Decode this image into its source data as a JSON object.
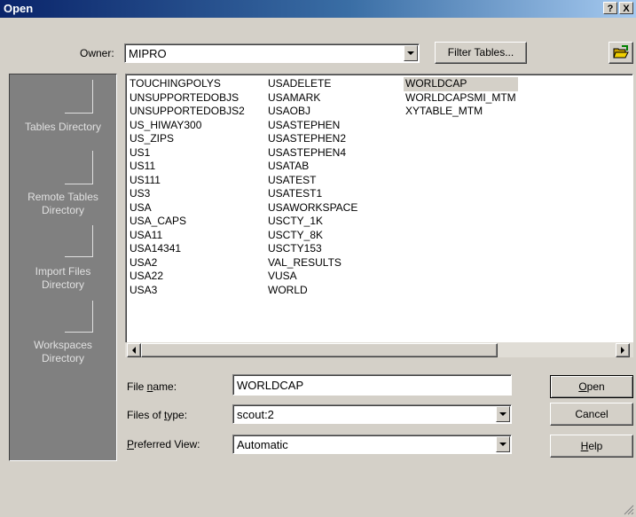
{
  "window": {
    "title": "Open",
    "help_glyph": "?",
    "close_glyph": "X"
  },
  "owner": {
    "label": "Owner:",
    "value": "MIPRO",
    "filter_button": "Filter Tables..."
  },
  "sidebar": {
    "items": [
      "Tables Directory",
      "Remote Tables Directory",
      "Import Files Directory",
      "Workspaces Directory"
    ]
  },
  "files": {
    "col1": [
      "TOUCHINGPOLYS",
      "UNSUPPORTEDOBJS",
      "UNSUPPORTEDOBJS2",
      "US_HIWAY300",
      "US_ZIPS",
      "US1",
      "US11",
      "US111",
      "US3",
      "USA",
      "USA_CAPS",
      "USA11",
      "USA14341",
      "USA2",
      "USA22",
      "USA3"
    ],
    "col2": [
      "USADELETE",
      "USAMARK",
      "USAOBJ",
      "USASTEPHEN",
      "USASTEPHEN2",
      "USASTEPHEN4",
      "USATAB",
      "USATEST",
      "USATEST1",
      "USAWORKSPACE",
      "USCTY_1K",
      "USCTY_8K",
      "USCTY153",
      "VAL_RESULTS",
      "VUSA",
      "WORLD"
    ],
    "col3": [
      "WORLDCAP",
      "WORLDCAPSMI_MTM",
      "XYTABLE_MTM"
    ],
    "selected": "WORLDCAP"
  },
  "filename": {
    "label_pre": "File ",
    "label_u": "n",
    "label_post": "ame:",
    "value": "WORLDCAP"
  },
  "filetype": {
    "label_pre": "Files of ",
    "label_u": "t",
    "label_post": "ype:",
    "value": "scout:2"
  },
  "preferred": {
    "label_u": "P",
    "label_post": "referred View:",
    "value": "Automatic"
  },
  "buttons": {
    "open": {
      "u": "O",
      "rest": "pen"
    },
    "cancel": "Cancel",
    "help": {
      "u": "H",
      "rest": "elp"
    }
  },
  "colors": {
    "title_start": "#0a246a",
    "title_end": "#a6caf0",
    "face": "#d4d0c8",
    "sidebar": "#808080"
  }
}
